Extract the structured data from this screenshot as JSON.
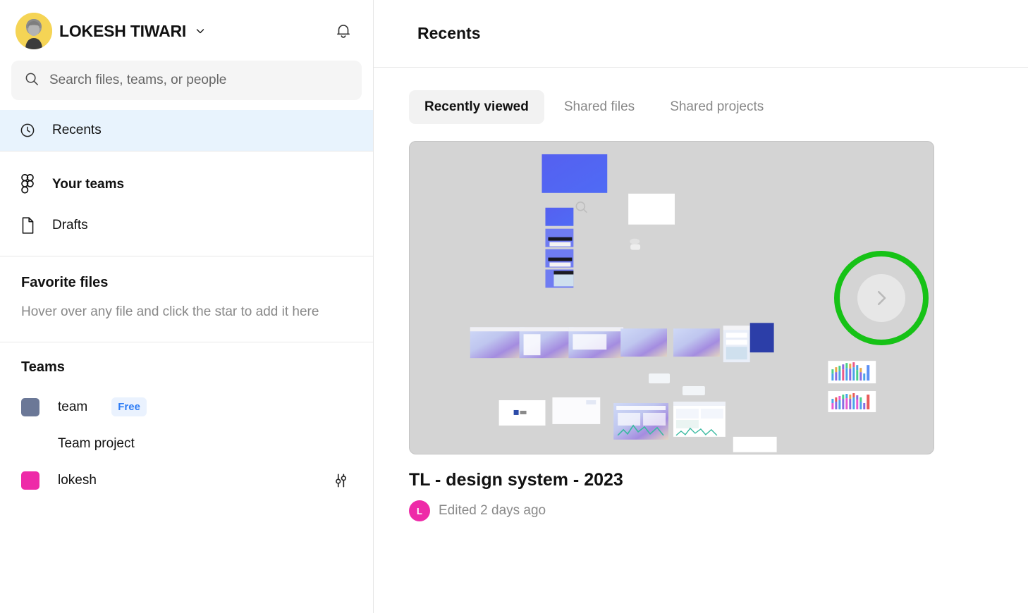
{
  "sidebar": {
    "user": {
      "name": "LOKESH TIWARI",
      "chevron_icon": "chevron-down-icon",
      "avatar_icon": "user-avatar"
    },
    "notifications_icon": "bell-icon",
    "search": {
      "placeholder": "Search files, teams, or people",
      "value": "",
      "icon": "search-icon"
    },
    "nav": [
      {
        "label": "Recents",
        "icon": "clock-icon",
        "active": true
      },
      {
        "label": "Your teams",
        "icon": "figma-icon",
        "active": false
      },
      {
        "label": "Drafts",
        "icon": "document-icon",
        "active": false
      }
    ],
    "favorites": {
      "title": "Favorite files",
      "hint": "Hover over any file and click the star to add it here"
    },
    "teams": {
      "title": "Teams",
      "items": [
        {
          "name": "team",
          "badge": "Free",
          "swatch_color": "#6b7897"
        },
        {
          "name": "lokesh",
          "badge": "",
          "swatch_color": "#ee2aa8",
          "settings_icon": "sliders-icon"
        }
      ],
      "projects": [
        {
          "name": "Team project"
        }
      ]
    }
  },
  "main": {
    "header": {
      "title": "Recents"
    },
    "tabs": [
      {
        "label": "Recently viewed",
        "active": true
      },
      {
        "label": "Shared files",
        "active": false
      },
      {
        "label": "Shared projects",
        "active": false
      }
    ],
    "file_card": {
      "title": "TL - design system - 2023",
      "editor_initial": "L",
      "edited_text": "Edited 2 days ago",
      "next_button_icon": "chevron-right-icon",
      "highlight_color": "#16c216"
    }
  }
}
